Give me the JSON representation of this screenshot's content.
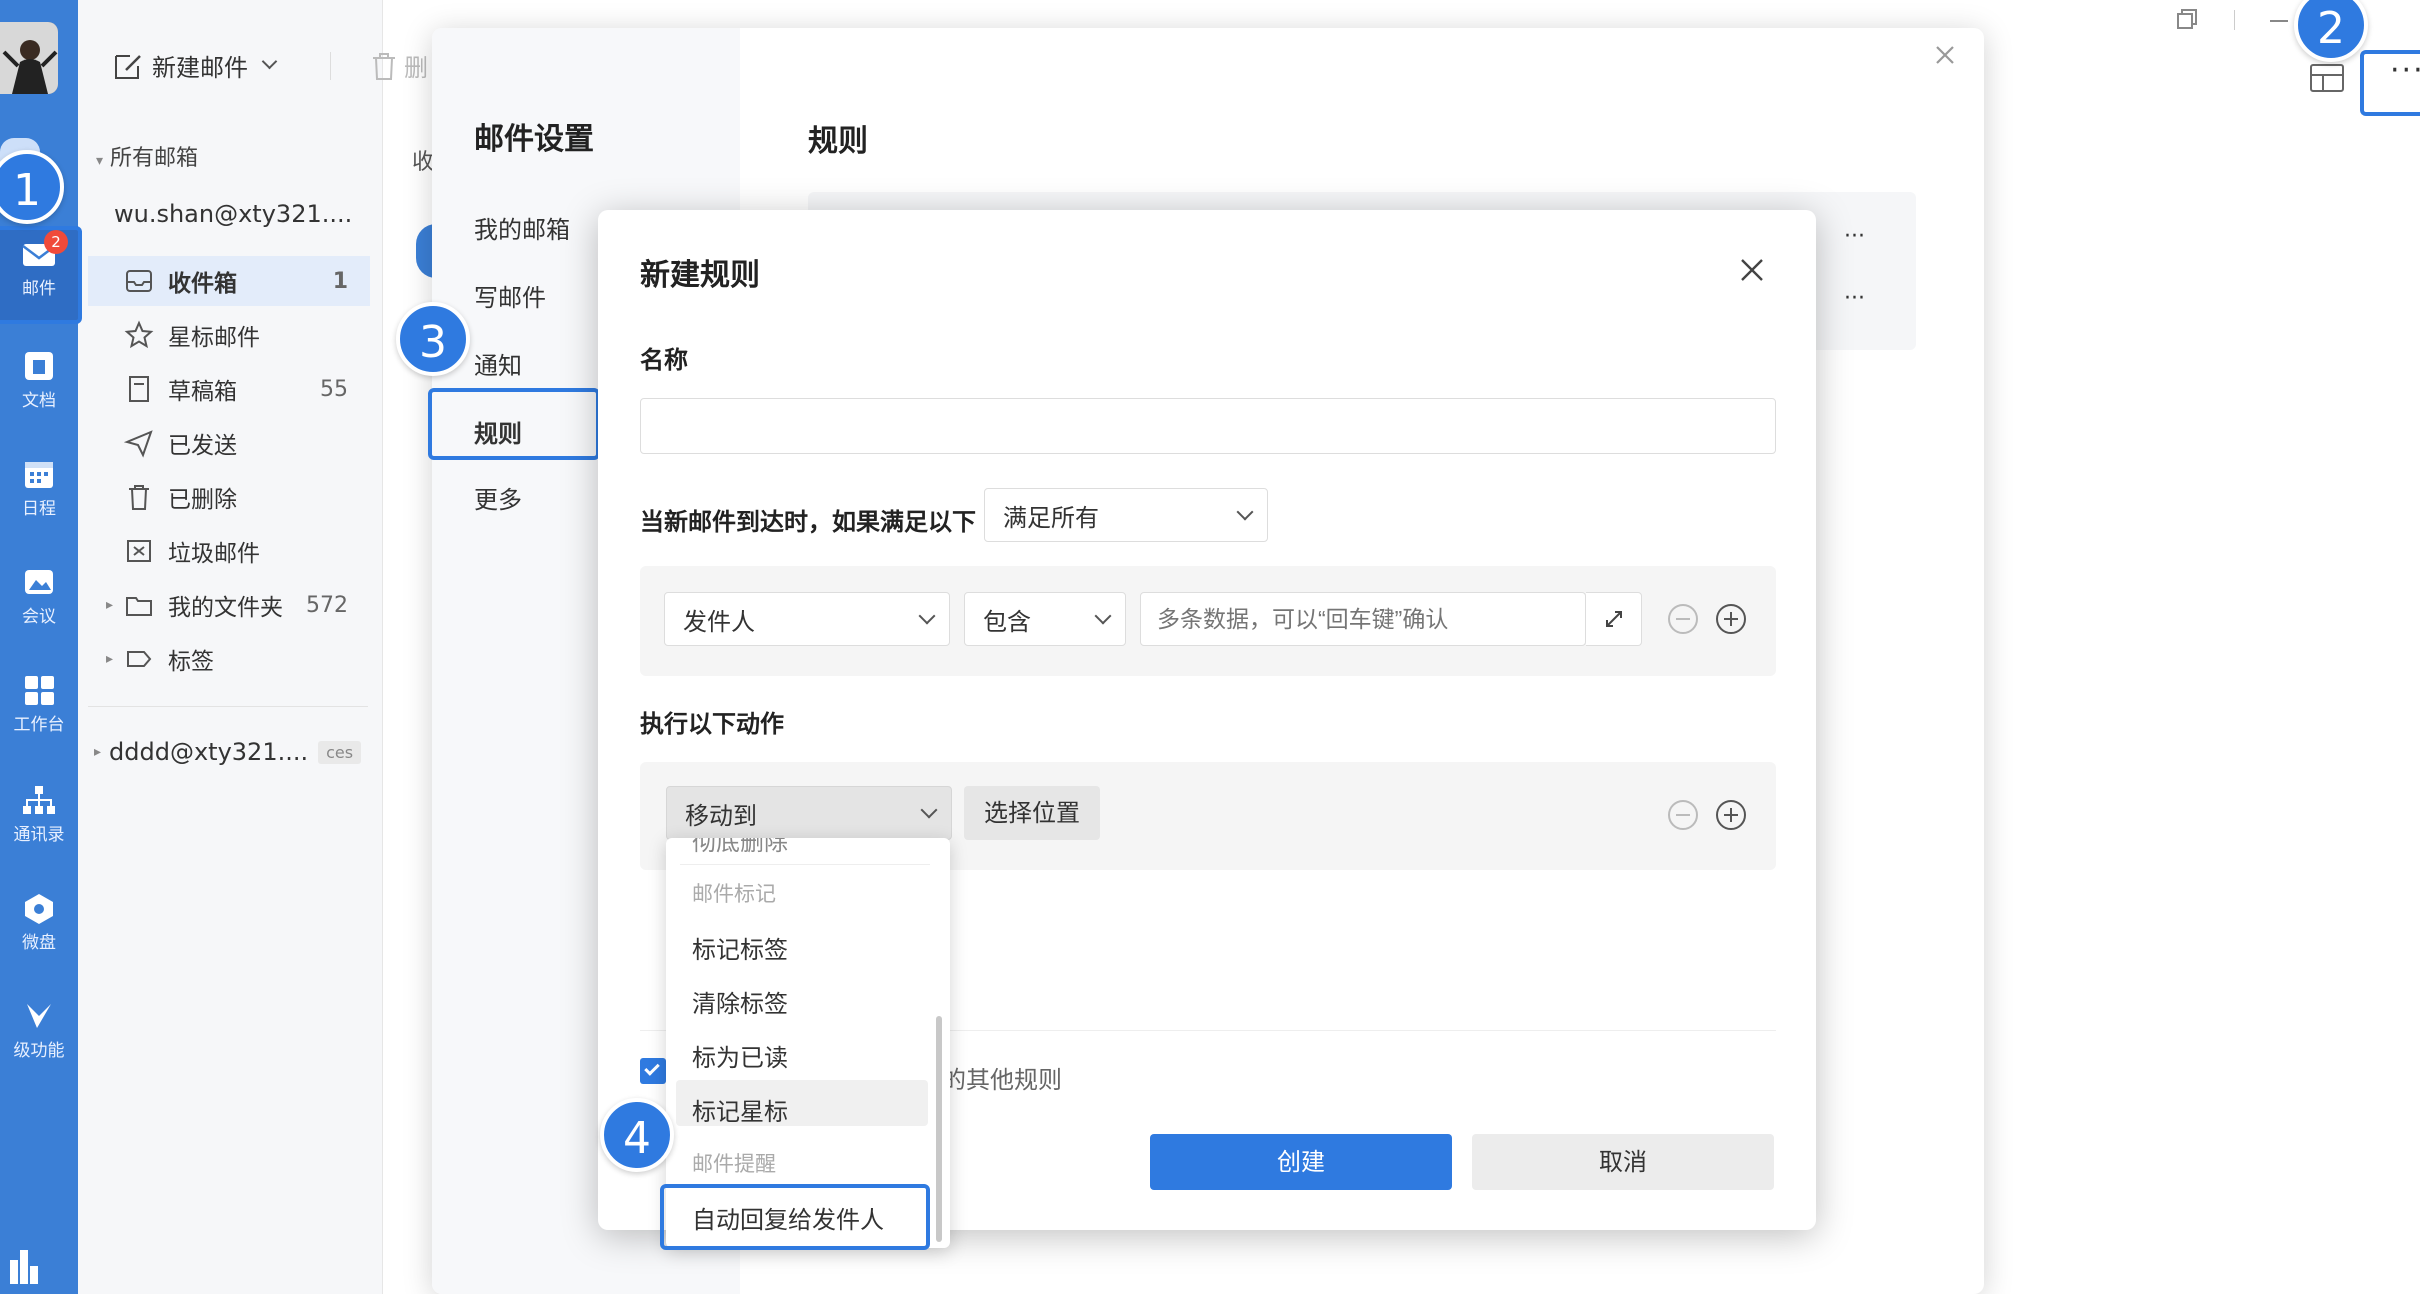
{
  "rail": {
    "items": [
      {
        "label": "邮件",
        "badge": "2"
      },
      {
        "label": "文档"
      },
      {
        "label": "日程"
      },
      {
        "label": "会议"
      },
      {
        "label": "工作台"
      },
      {
        "label": "通讯录"
      },
      {
        "label": "微盘"
      },
      {
        "label": "级功能"
      }
    ]
  },
  "toolbar": {
    "new_mail": "新建邮件",
    "delete_partial": "删"
  },
  "folders": {
    "all_mailboxes": "所有邮箱",
    "account": "wu.shan@xty321....",
    "items": [
      {
        "label": "收件箱",
        "count": "1"
      },
      {
        "label": "星标邮件",
        "count": ""
      },
      {
        "label": "草稿箱",
        "count": "55"
      },
      {
        "label": "已发送",
        "count": ""
      },
      {
        "label": "已删除",
        "count": ""
      },
      {
        "label": "垃圾邮件",
        "count": ""
      },
      {
        "label": "我的文件夹",
        "count": "572"
      },
      {
        "label": "标签",
        "count": ""
      }
    ],
    "account2": "dddd@xty321....",
    "account2_tag": "ces",
    "list_header_partial": "收"
  },
  "settings": {
    "title": "邮件设置",
    "nav": [
      "我的邮箱",
      "写邮件",
      "通知",
      "规则",
      "更多"
    ],
    "section_title": "规则",
    "more_dots": "···"
  },
  "dialog": {
    "title": "新建规则",
    "name_label": "名称",
    "name_value": "",
    "condition_label": "当新邮件到达时，如果满足以下",
    "condition_mode": "满足所有",
    "cond_field": "发件人",
    "cond_op": "包含",
    "cond_placeholder": "多条数据，可以“回车键”确认",
    "action_label": "执行以下动作",
    "action_select": "移动到",
    "choose_location": "选择位置",
    "other_rules_partial": "的其他规则",
    "create_btn": "创建",
    "cancel_btn": "取消"
  },
  "dropdown": {
    "partial_top": "彻底删除",
    "group1": "邮件标记",
    "items": [
      "标记标签",
      "清除标签",
      "标为已读",
      "标记星标"
    ],
    "group2": "邮件提醒",
    "auto_reply": "自动回复给发件人"
  },
  "callouts": [
    "1",
    "2",
    "3",
    "4"
  ],
  "colors": {
    "primary": "#2f7ae0",
    "rail": "#3b7fd6",
    "badge": "#f04a3a"
  }
}
